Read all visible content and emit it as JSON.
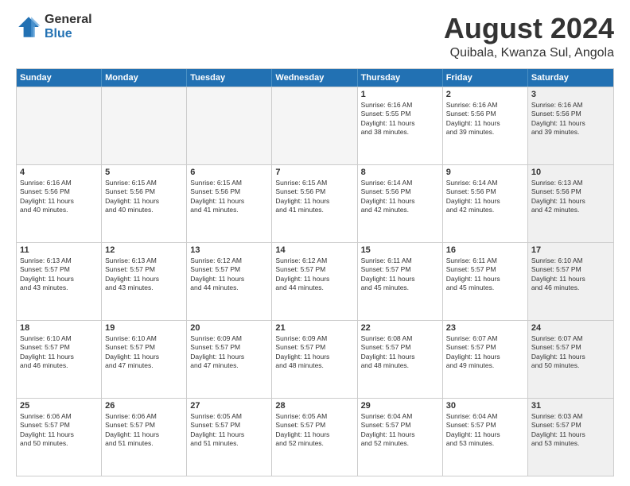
{
  "logo": {
    "general": "General",
    "blue": "Blue"
  },
  "title": "August 2024",
  "subtitle": "Quibala, Kwanza Sul, Angola",
  "header_days": [
    "Sunday",
    "Monday",
    "Tuesday",
    "Wednesday",
    "Thursday",
    "Friday",
    "Saturday"
  ],
  "weeks": [
    [
      {
        "day": "",
        "info": "",
        "shaded": true
      },
      {
        "day": "",
        "info": "",
        "shaded": true
      },
      {
        "day": "",
        "info": "",
        "shaded": true
      },
      {
        "day": "",
        "info": "",
        "shaded": true
      },
      {
        "day": "1",
        "info": "Sunrise: 6:16 AM\nSunset: 5:55 PM\nDaylight: 11 hours\nand 38 minutes.",
        "shaded": false
      },
      {
        "day": "2",
        "info": "Sunrise: 6:16 AM\nSunset: 5:56 PM\nDaylight: 11 hours\nand 39 minutes.",
        "shaded": false
      },
      {
        "day": "3",
        "info": "Sunrise: 6:16 AM\nSunset: 5:56 PM\nDaylight: 11 hours\nand 39 minutes.",
        "shaded": true
      }
    ],
    [
      {
        "day": "4",
        "info": "Sunrise: 6:16 AM\nSunset: 5:56 PM\nDaylight: 11 hours\nand 40 minutes.",
        "shaded": false
      },
      {
        "day": "5",
        "info": "Sunrise: 6:15 AM\nSunset: 5:56 PM\nDaylight: 11 hours\nand 40 minutes.",
        "shaded": false
      },
      {
        "day": "6",
        "info": "Sunrise: 6:15 AM\nSunset: 5:56 PM\nDaylight: 11 hours\nand 41 minutes.",
        "shaded": false
      },
      {
        "day": "7",
        "info": "Sunrise: 6:15 AM\nSunset: 5:56 PM\nDaylight: 11 hours\nand 41 minutes.",
        "shaded": false
      },
      {
        "day": "8",
        "info": "Sunrise: 6:14 AM\nSunset: 5:56 PM\nDaylight: 11 hours\nand 42 minutes.",
        "shaded": false
      },
      {
        "day": "9",
        "info": "Sunrise: 6:14 AM\nSunset: 5:56 PM\nDaylight: 11 hours\nand 42 minutes.",
        "shaded": false
      },
      {
        "day": "10",
        "info": "Sunrise: 6:13 AM\nSunset: 5:56 PM\nDaylight: 11 hours\nand 42 minutes.",
        "shaded": true
      }
    ],
    [
      {
        "day": "11",
        "info": "Sunrise: 6:13 AM\nSunset: 5:57 PM\nDaylight: 11 hours\nand 43 minutes.",
        "shaded": false
      },
      {
        "day": "12",
        "info": "Sunrise: 6:13 AM\nSunset: 5:57 PM\nDaylight: 11 hours\nand 43 minutes.",
        "shaded": false
      },
      {
        "day": "13",
        "info": "Sunrise: 6:12 AM\nSunset: 5:57 PM\nDaylight: 11 hours\nand 44 minutes.",
        "shaded": false
      },
      {
        "day": "14",
        "info": "Sunrise: 6:12 AM\nSunset: 5:57 PM\nDaylight: 11 hours\nand 44 minutes.",
        "shaded": false
      },
      {
        "day": "15",
        "info": "Sunrise: 6:11 AM\nSunset: 5:57 PM\nDaylight: 11 hours\nand 45 minutes.",
        "shaded": false
      },
      {
        "day": "16",
        "info": "Sunrise: 6:11 AM\nSunset: 5:57 PM\nDaylight: 11 hours\nand 45 minutes.",
        "shaded": false
      },
      {
        "day": "17",
        "info": "Sunrise: 6:10 AM\nSunset: 5:57 PM\nDaylight: 11 hours\nand 46 minutes.",
        "shaded": true
      }
    ],
    [
      {
        "day": "18",
        "info": "Sunrise: 6:10 AM\nSunset: 5:57 PM\nDaylight: 11 hours\nand 46 minutes.",
        "shaded": false
      },
      {
        "day": "19",
        "info": "Sunrise: 6:10 AM\nSunset: 5:57 PM\nDaylight: 11 hours\nand 47 minutes.",
        "shaded": false
      },
      {
        "day": "20",
        "info": "Sunrise: 6:09 AM\nSunset: 5:57 PM\nDaylight: 11 hours\nand 47 minutes.",
        "shaded": false
      },
      {
        "day": "21",
        "info": "Sunrise: 6:09 AM\nSunset: 5:57 PM\nDaylight: 11 hours\nand 48 minutes.",
        "shaded": false
      },
      {
        "day": "22",
        "info": "Sunrise: 6:08 AM\nSunset: 5:57 PM\nDaylight: 11 hours\nand 48 minutes.",
        "shaded": false
      },
      {
        "day": "23",
        "info": "Sunrise: 6:07 AM\nSunset: 5:57 PM\nDaylight: 11 hours\nand 49 minutes.",
        "shaded": false
      },
      {
        "day": "24",
        "info": "Sunrise: 6:07 AM\nSunset: 5:57 PM\nDaylight: 11 hours\nand 50 minutes.",
        "shaded": true
      }
    ],
    [
      {
        "day": "25",
        "info": "Sunrise: 6:06 AM\nSunset: 5:57 PM\nDaylight: 11 hours\nand 50 minutes.",
        "shaded": false
      },
      {
        "day": "26",
        "info": "Sunrise: 6:06 AM\nSunset: 5:57 PM\nDaylight: 11 hours\nand 51 minutes.",
        "shaded": false
      },
      {
        "day": "27",
        "info": "Sunrise: 6:05 AM\nSunset: 5:57 PM\nDaylight: 11 hours\nand 51 minutes.",
        "shaded": false
      },
      {
        "day": "28",
        "info": "Sunrise: 6:05 AM\nSunset: 5:57 PM\nDaylight: 11 hours\nand 52 minutes.",
        "shaded": false
      },
      {
        "day": "29",
        "info": "Sunrise: 6:04 AM\nSunset: 5:57 PM\nDaylight: 11 hours\nand 52 minutes.",
        "shaded": false
      },
      {
        "day": "30",
        "info": "Sunrise: 6:04 AM\nSunset: 5:57 PM\nDaylight: 11 hours\nand 53 minutes.",
        "shaded": false
      },
      {
        "day": "31",
        "info": "Sunrise: 6:03 AM\nSunset: 5:57 PM\nDaylight: 11 hours\nand 53 minutes.",
        "shaded": true
      }
    ]
  ]
}
